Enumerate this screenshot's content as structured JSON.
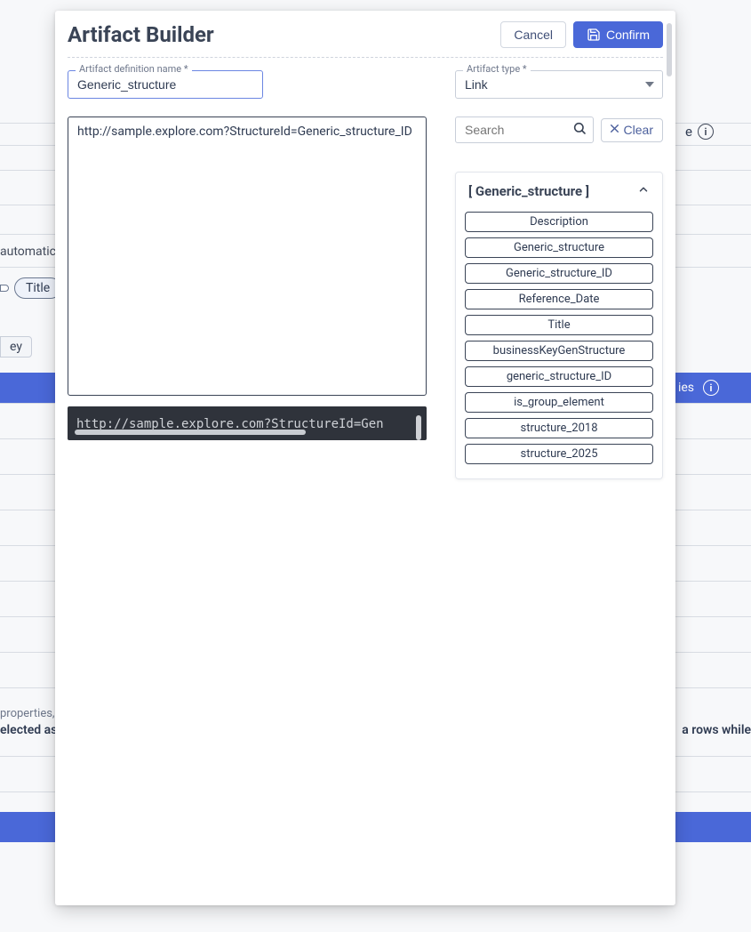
{
  "bg": {
    "automatic_text": "automatic",
    "chip_title": "Title",
    "chip_ey": "ey",
    "right_label": "e",
    "blue_header_right": "ies",
    "hint1": "properties, u",
    "hint2": "elected as",
    "hint3": "a rows while"
  },
  "modal": {
    "title": "Artifact Builder",
    "cancel": "Cancel",
    "confirm": "Confirm"
  },
  "left": {
    "name_label": "Artifact definition name *",
    "name_value": "Generic_structure",
    "editor_text": "http://sample.explore.com?StructureId=Generic_structure_ID",
    "preview_text": "http://sample.explore.com?StructureId=Gen"
  },
  "right": {
    "type_label": "Artifact type *",
    "type_value": "Link",
    "search_placeholder": "Search",
    "clear_label": "Clear",
    "panel_title": "[ Generic_structure ]",
    "attributes": [
      "Description",
      "Generic_structure",
      "Generic_structure_ID",
      "Reference_Date",
      "Title",
      "businessKeyGenStructure",
      "generic_structure_ID",
      "is_group_element",
      "structure_2018",
      "structure_2025"
    ]
  }
}
